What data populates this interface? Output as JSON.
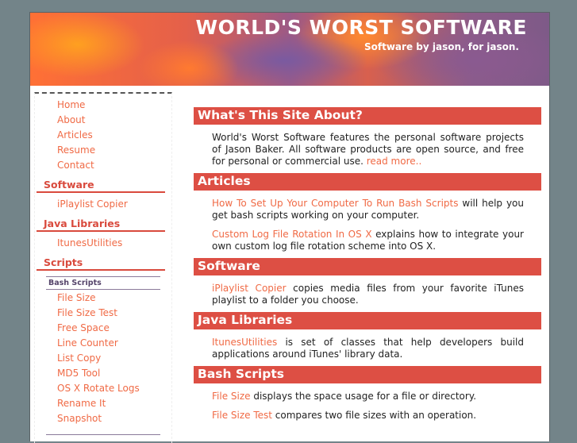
{
  "header": {
    "title": "WORLD'S WORST SOFTWARE",
    "subtitle": "Software by jason, for jason."
  },
  "sidebar": {
    "nav": [
      "Home",
      "About",
      "Articles",
      "Resume",
      "Contact"
    ],
    "software_heading": "Software",
    "software": [
      "iPlaylist Copier"
    ],
    "java_heading": "Java Libraries",
    "java": [
      "ItunesUtilities"
    ],
    "scripts_heading": "Scripts",
    "bash_heading": "Bash Scripts",
    "bash": [
      "File Size",
      "File Size Test",
      "Free Space",
      "Line Counter",
      "List Copy",
      "MD5 Tool",
      "OS X Rotate Logs",
      "Rename It",
      "Snapshot"
    ]
  },
  "main": {
    "about": {
      "heading": "What's This Site About?",
      "text": "World's Worst Software features the personal software projects of Jason Baker. All software products are open source, and free for personal or commercial use. ",
      "link": "read more.."
    },
    "articles": {
      "heading": "Articles",
      "items": [
        {
          "link": "How To Set Up Your Computer To Run Bash Scripts",
          "text": " will help you get bash scripts working on your computer."
        },
        {
          "link": "Custom Log File Rotation In OS X",
          "text": " explains how to integrate your own custom log file rotation scheme into OS X."
        }
      ]
    },
    "software": {
      "heading": "Software",
      "items": [
        {
          "link": "iPlaylist Copier",
          "text": " copies media files from your favorite iTunes playlist to a folder you choose."
        }
      ]
    },
    "java": {
      "heading": "Java Libraries",
      "items": [
        {
          "link": "ItunesUtilities",
          "text": " is set of classes that help developers build applications around iTunes' library data."
        }
      ]
    },
    "bash": {
      "heading": "Bash Scripts",
      "items": [
        {
          "link": "File Size",
          "text": " displays the space usage for a file or directory."
        },
        {
          "link": "File Size Test",
          "text": " compares two file sizes with an operation."
        }
      ]
    }
  },
  "colors": {
    "background": "#738489",
    "accent": "#dd4f44",
    "link": "#f06a45"
  }
}
